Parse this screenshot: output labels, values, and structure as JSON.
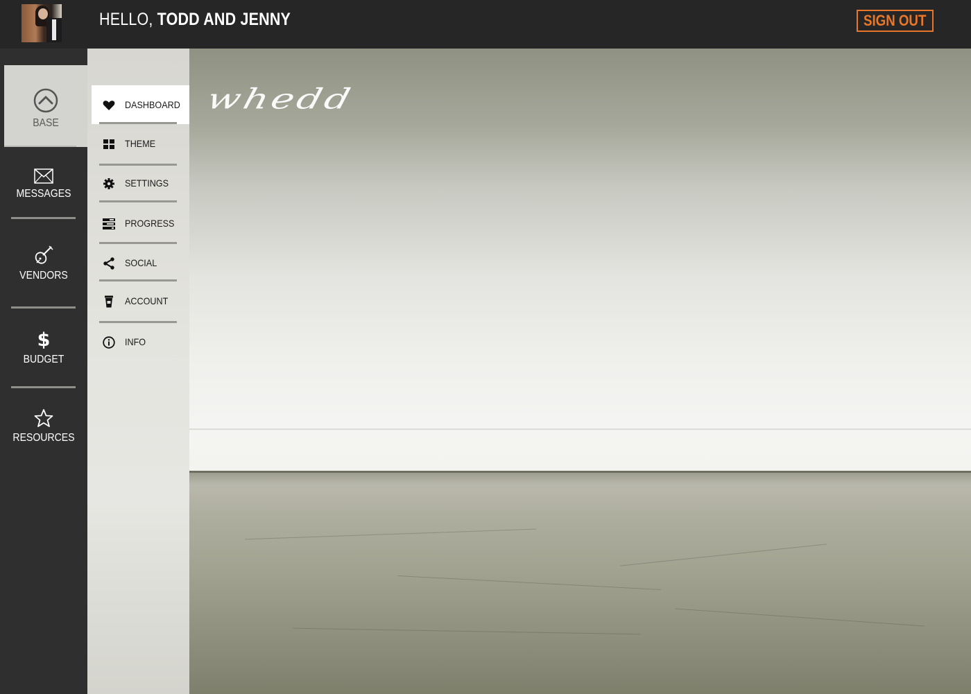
{
  "header": {
    "greeting_prefix": "HELLO,",
    "greeting_names": "TODD AND JENNY",
    "signout_label": "SIGN OUT",
    "accent_color": "#e8772a"
  },
  "sidebar": {
    "items": [
      {
        "label": "BASE",
        "icon": "chevron-up-circle-icon",
        "active": true
      },
      {
        "label": "MESSAGES",
        "icon": "envelope-icon"
      },
      {
        "label": "VENDORS",
        "icon": "violin-icon"
      },
      {
        "label": "BUDGET",
        "icon": "dollar-icon"
      },
      {
        "label": "RESOURCES",
        "icon": "star-icon"
      }
    ]
  },
  "submenu": {
    "items": [
      {
        "label": "DASHBOARD",
        "icon": "heart-icon",
        "active": true
      },
      {
        "label": "THEME",
        "icon": "grid-icon"
      },
      {
        "label": "SETTINGS",
        "icon": "gear-icon"
      },
      {
        "label": "PROGRESS",
        "icon": "bars-icon"
      },
      {
        "label": "SOCIAL",
        "icon": "share-icon"
      },
      {
        "label": "ACCOUNT",
        "icon": "cup-icon"
      },
      {
        "label": "INFO",
        "icon": "info-icon"
      }
    ]
  },
  "main": {
    "logo_text": "whedd"
  }
}
